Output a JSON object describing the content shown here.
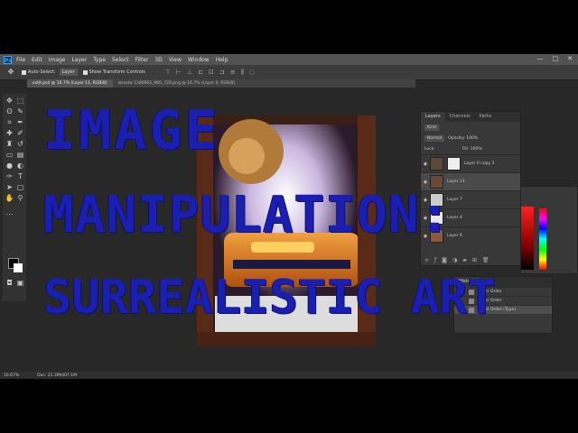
{
  "menubar": {
    "app_icon": "Ps",
    "items": [
      "File",
      "Edit",
      "Image",
      "Layer",
      "Type",
      "Select",
      "Filter",
      "3D",
      "View",
      "Window",
      "Help"
    ],
    "controls": [
      "—",
      "□",
      "✕"
    ]
  },
  "options": {
    "auto_select_label": "Auto-Select:",
    "auto_select_value": "Layer",
    "transform_controls_label": "Show Transform Controls"
  },
  "tabs": [
    {
      "label": "ostit.psd @ 16.7% (Layer 11, RGB/8)"
    },
    {
      "label": "wssolw 1280962_960_720.png @ 16.7% (Layer 0, RGB/8)"
    }
  ],
  "layers_panel": {
    "tabs": [
      "Layers",
      "Channels",
      "Paths"
    ],
    "kind_label": "Kind",
    "blend_mode": "Normal",
    "opacity_label": "Opacity: 100%",
    "lock_label": "Lock:",
    "fill_label": "Fill: 100%",
    "layers": [
      {
        "name": "Layer 0 copy 3"
      },
      {
        "name": "Layer 11"
      },
      {
        "name": "Layer 7"
      },
      {
        "name": "Layer 4"
      },
      {
        "name": "Layer 6"
      }
    ]
  },
  "history_panel": {
    "title": "History",
    "items": [
      "Layer Order",
      "Layer Order",
      "Layer Order (Type)"
    ]
  },
  "status": {
    "zoom": "16.67%",
    "doc": "Doc: 21.2M/407.1M"
  },
  "overlay": {
    "lines": [
      "IMAGE",
      "MANIPULATION:",
      "SURREALISTIC ART"
    ]
  },
  "colors": {
    "overlay_text": "#1a1fb0",
    "ui_bg": "#282828",
    "panel_bg": "#383838"
  }
}
